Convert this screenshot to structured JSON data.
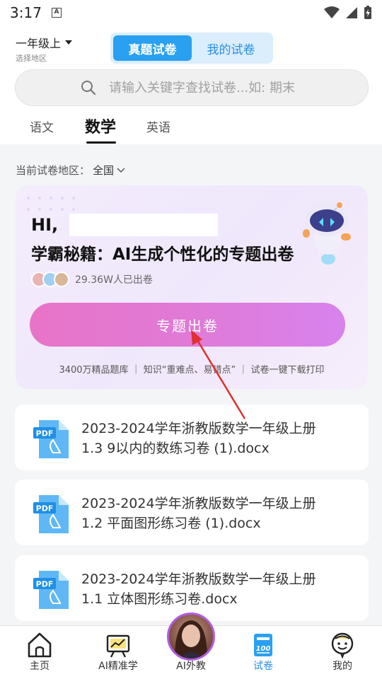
{
  "status": {
    "time": "3:17",
    "a_badge": "A"
  },
  "header": {
    "grade": "一年级上",
    "grade_sub": "选择地区",
    "segments": [
      "真题试卷",
      "我的试卷"
    ],
    "search_placeholder": "请输入关键字查找试卷...如: 期末"
  },
  "subject_tabs": [
    "语文",
    "数学",
    "英语"
  ],
  "region": {
    "label": "当前试卷地区：",
    "value": "全国"
  },
  "promo": {
    "hi": "HI,",
    "title": "学霸秘籍：AI生成个性化的专题出卷",
    "count": "29.36W人已出卷",
    "button": "专题出卷",
    "features": "3400万精品题库 ｜ 知识“重难点、易错点” ｜ 试卷一键下载打印"
  },
  "documents": [
    {
      "line1": "2023-2024学年浙教版数学一年级上册",
      "line2": "1.3 9以内的数练习卷 (1).docx",
      "icon": "pdf-icon"
    },
    {
      "line1": "2023-2024学年浙教版数学一年级上册",
      "line2": "1.2 平面图形练习卷 (1).docx",
      "icon": "pdf-icon"
    },
    {
      "line1": "2023-2024学年浙教版数学一年级上册",
      "line2": "1.1 立体图形练习卷.docx",
      "icon": "pdf-icon"
    }
  ],
  "pdf_badge": "PDF",
  "bottom_nav": [
    "主页",
    "AI精准学",
    "AI外教",
    "试卷",
    "我的"
  ],
  "colors": {
    "accent": "#2aa0f0",
    "promo_button": "#e07ad6",
    "active_nav": "#2a8ee6"
  }
}
